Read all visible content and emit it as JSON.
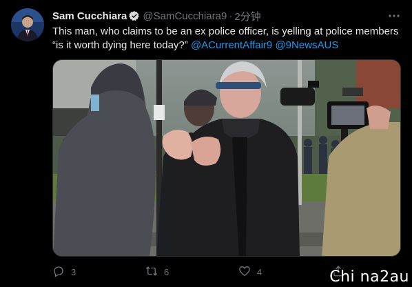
{
  "tweet": {
    "display_name": "Sam Cucchiara",
    "handle": "@SamCucchiara9",
    "separator": "·",
    "timestamp": "2分钟",
    "text_line1": "This man, who claims to be an ex police officer, is yelling at police members",
    "text_line2_quote": "“is it worth dying here today?”",
    "mention1": "@ACurrentAffair9",
    "mention2": "@9NewsAUS"
  },
  "actions": {
    "reply_count": "3",
    "retweet_count": "6",
    "like_count": "4"
  },
  "watermark": "Chi na2au",
  "icons": {
    "verified": "verified-badge-icon",
    "more": "more-options-icon",
    "reply": "reply-icon",
    "retweet": "retweet-icon",
    "like": "heart-icon",
    "share": "share-icon"
  },
  "colors": {
    "background": "#000000",
    "text": "#e7e9ea",
    "secondary": "#71767b",
    "link": "#1d9bf0"
  }
}
